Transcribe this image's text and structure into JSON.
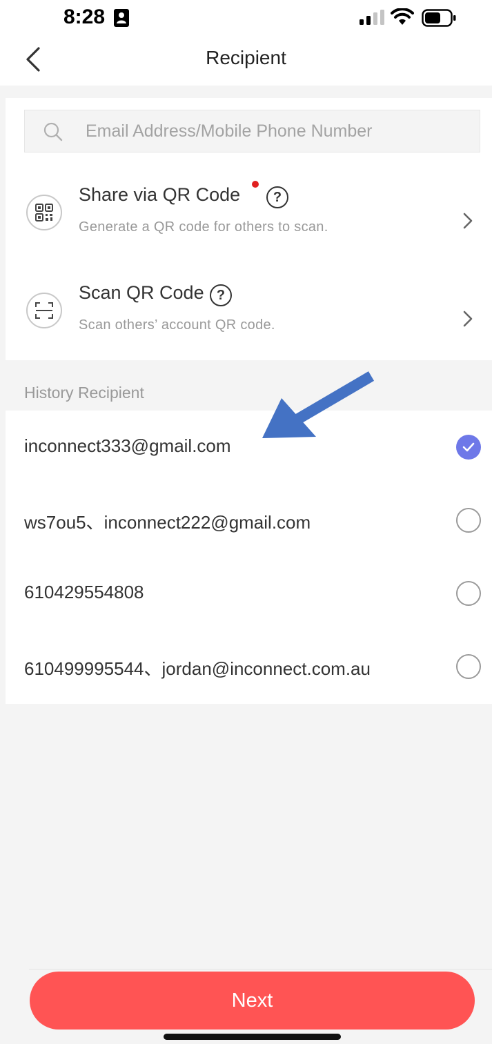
{
  "status_bar": {
    "time": "8:28"
  },
  "nav": {
    "title": "Recipient"
  },
  "search": {
    "placeholder": "Email Address/Mobile Phone Number",
    "value": ""
  },
  "options": [
    {
      "title": "Share via QR Code",
      "subtitle": "Generate a QR code for others to scan.",
      "icon": "qr-code-icon",
      "has_new_dot": true
    },
    {
      "title": "Scan QR Code",
      "subtitle": "Scan others’ account QR code.",
      "icon": "scan-frame-icon",
      "has_new_dot": false
    }
  ],
  "history": {
    "header": "History Recipient",
    "items": [
      {
        "label": "inconnect333@gmail.com",
        "selected": true
      },
      {
        "label": "ws7ou5、inconnect222@gmail.com",
        "selected": false
      },
      {
        "label": "610429554808",
        "selected": false
      },
      {
        "label": "610499995544、jordan@inconnect.com.au",
        "selected": false
      }
    ]
  },
  "actions": {
    "next_label": "Next"
  },
  "colors": {
    "accent_red": "#ff5454",
    "selected_purple": "#6e78e8",
    "annotation_blue": "#4472c4",
    "new_dot_red": "#e02020"
  }
}
